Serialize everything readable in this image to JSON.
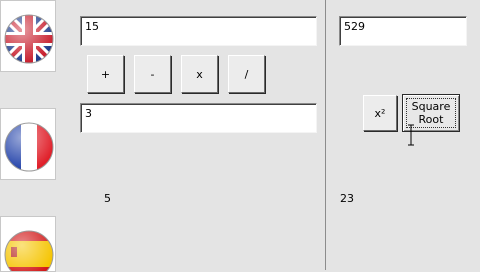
{
  "flags": [
    {
      "name": "United Kingdom"
    },
    {
      "name": "France"
    },
    {
      "name": "Spain"
    }
  ],
  "left": {
    "input1_value": "15",
    "input2_value": "3",
    "result_value": "5",
    "ops": {
      "add": "+",
      "subtract": "-",
      "multiply": "x",
      "divide": "/"
    }
  },
  "right": {
    "output_value": "529",
    "square_label": "x²",
    "square_root_line1": "Square",
    "square_root_line2": "Root",
    "result_value": "23"
  },
  "colors": {
    "background": "#e4e4e4",
    "textbox": "#ffffff",
    "divider": "#8c8c8c"
  }
}
